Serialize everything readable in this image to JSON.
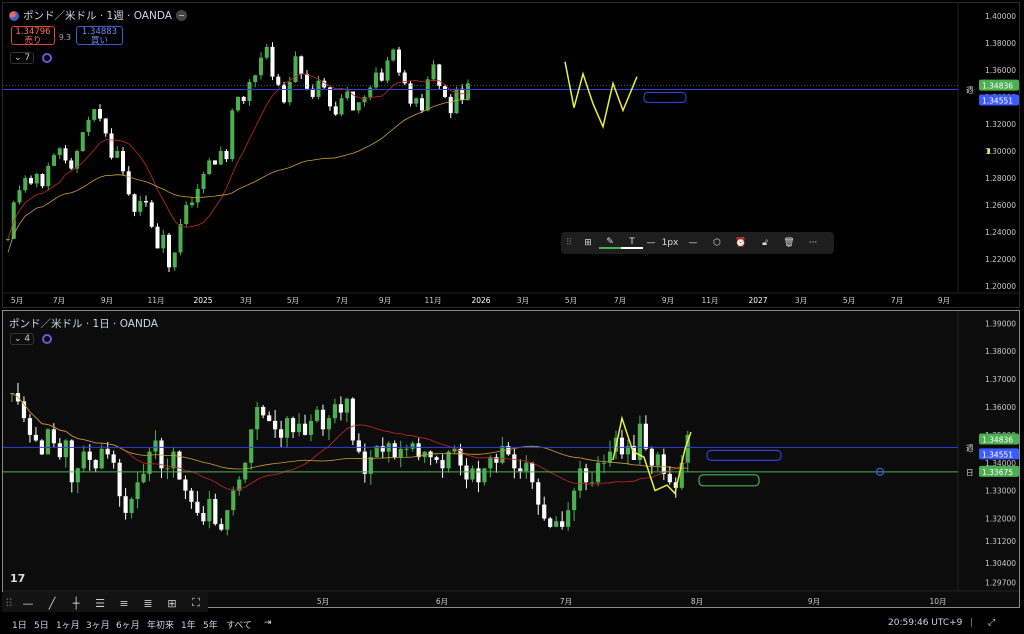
{
  "top": {
    "title": "ポンド／米ドル · 1週 · OANDA",
    "sell_price": "1.34796",
    "sell_label": "売り",
    "spread": "9.3",
    "buy_price": "1.34883",
    "buy_label": "買い",
    "indicator_count": "7",
    "y_ticks": [
      "1.40000",
      "1.38000",
      "1.36000",
      "1.34000",
      "1.32000",
      "1.30000",
      "1.28000",
      "1.26000",
      "1.24000",
      "1.22000",
      "1.20000"
    ],
    "x_ticks": [
      "5月",
      "7月",
      "9月",
      "11月",
      "2025",
      "3月",
      "5月",
      "7月",
      "9月",
      "11月",
      "2026",
      "3月",
      "5月",
      "7月",
      "9月",
      "11月",
      "2027",
      "3月",
      "5月",
      "7月",
      "9月"
    ],
    "price_tags": {
      "last": "1.34836",
      "line": "1.34551",
      "line_label": "週"
    },
    "marker_value": "1.30000"
  },
  "bottom": {
    "title": "ポンド／米ドル · 1日 · OANDA",
    "indicator_count": "4",
    "y_ticks": [
      "1.39000",
      "1.38000",
      "1.37000",
      "1.36000",
      "1.35000",
      "1.34000",
      "1.33000",
      "1.32000",
      "1.31200",
      "1.30400",
      "1.29700"
    ],
    "x_ticks": [
      "5月",
      "6月",
      "7月",
      "8月",
      "9月",
      "10月"
    ],
    "price_tags": {
      "last": "1.34836",
      "line": "1.34551",
      "line_label": "週",
      "green": "1.33675",
      "green_label": "日"
    }
  },
  "drawing_toolbar": {
    "width_label": "1px"
  },
  "bottom_bar": {
    "timeframes": [
      "1日",
      "5日",
      "1ヶ月",
      "3ヶ月",
      "6ヶ月",
      "年初来",
      "1年",
      "5年",
      "すべて"
    ],
    "clock": "20:59:46 UTC+9"
  },
  "colors": {
    "bg": "#000000",
    "up": "#26a69a",
    "green_candle": "#4caf50",
    "down": "#ffffff",
    "ma_red": "#c62828",
    "ma_yellow": "#c8a232",
    "line_blue": "#2f3fd8",
    "line_green": "#4caf50",
    "highlight": "#e8f03a"
  },
  "chart_data": [
    {
      "type": "candlestick",
      "title": "ポンド／米ドル · 1週 · OANDA",
      "ylim": [
        1.195,
        1.405
      ]
    },
    {
      "type": "candlestick",
      "title": "ポンド／米ドル · 1日 · OANDA",
      "ylim": [
        1.294,
        1.393
      ]
    }
  ]
}
